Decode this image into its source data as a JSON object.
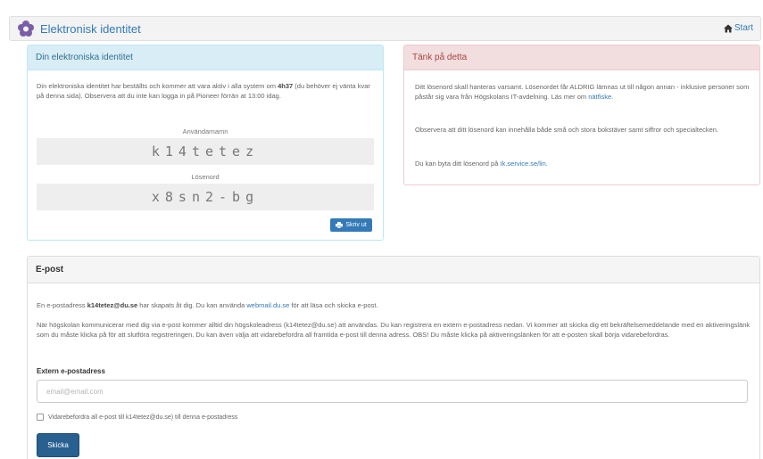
{
  "navbar": {
    "title": "Elektronisk identitet",
    "home_label": "Start",
    "logo_icon": "flower-icon",
    "home_icon": "home-icon"
  },
  "identity_panel": {
    "heading": "Din elektroniska identitet",
    "intro_a": "Din elektroniska identitet har beställts och kommer att vara aktiv i alla system om ",
    "intro_time": "4h37",
    "intro_b": " (du behöver ej vänta kvar på denna sida). Observera att du inte kan logga in på Pioneer förrän at 13:00 idag.",
    "username_label": "Användarnamn",
    "username_value": "k14tetez",
    "password_label": "Lösenord",
    "password_value": "x8sn2-bg",
    "print_button": "Skriv ut"
  },
  "think_panel": {
    "heading": "Tänk på detta",
    "p1_a": "Ditt lösenord skall hanteras varsamt. Lösenordet får ALDRIG lämnas ut till någon annan - inklusive personer som påstår sig vara från Högskolans IT-avdelning. Läs mer om ",
    "p1_link": "nätfiske",
    "p1_b": ".",
    "p2": "Observera att ditt lösenord kan innehålla både små och stora bokstäver samt siffror och specialtecken.",
    "p3_a": "Du kan byta ditt lösenord på ",
    "p3_link": "Ik.service.se/lin",
    "p3_b": "."
  },
  "email_panel": {
    "heading": "E-post",
    "p1_a": "En e-postadress ",
    "p1_addr": "k14tetez@du.se",
    "p1_b": " har skapats åt dig. Du kan använda ",
    "p1_link": "webmail.du.se",
    "p1_c": " för att läsa och skicka e-post.",
    "p2": "När högskolan kommunicerar med dig via e-post kommer alltid din högskoleadress (k14tetez@du.se) att användas. Du kan registrera en extern e-postadress nedan. Vi kommer att skicka dig ett bekräftelsemeddelande med en aktiveringslänk som du måste klicka på för att slutföra registreringen. Du kan även välja att vidarebefordra all framtida e-post till denna adress. OBS! Du måste klicka på aktiveringslänken för att e-posten skall börja vidarebefordras.",
    "field_label": "Extern e-postadress",
    "field_placeholder": "email@email.com",
    "field_value": "",
    "checkbox_label": "Vidarebefordra all e-post till k14tetez@du.se) till denna e-postadress",
    "checkbox_checked": false,
    "submit_button": "Skicka"
  },
  "colors": {
    "primary": "#337ab7",
    "info_bg": "#d9edf7",
    "danger_bg": "#f2dede"
  }
}
